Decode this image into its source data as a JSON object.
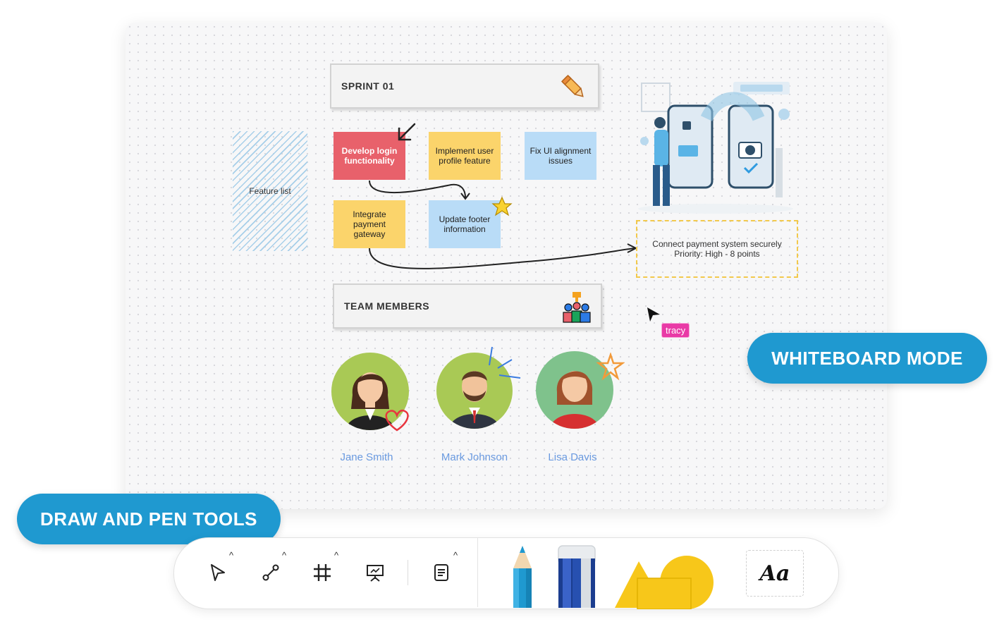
{
  "board": {
    "sprint_title": "SPRINT 01",
    "team_title": "TEAM MEMBERS",
    "feature_label": "Feature list",
    "stickies": [
      {
        "text": "Develop login functionality",
        "color": "#e8616b"
      },
      {
        "text": "Implement user profile feature",
        "color": "#fbd46b"
      },
      {
        "text": "Fix UI alignment issues",
        "color": "#b9dcf7"
      },
      {
        "text": "Integrate payment gateway",
        "color": "#fbd46b"
      },
      {
        "text": "Update footer information",
        "color": "#b9dcf7"
      }
    ],
    "payment_note": {
      "line1": "Connect payment system securely",
      "line2": "Priority: High - 8 points"
    },
    "members": [
      {
        "name": "Jane Smith"
      },
      {
        "name": "Mark Johnson"
      },
      {
        "name": "Lisa Davis"
      }
    ],
    "cursor_user": "tracy"
  },
  "badges": {
    "whiteboard_mode": "WHITEBOARD MODE",
    "draw_tools": "DRAW AND PEN TOOLS"
  },
  "toolbar": {
    "tools": [
      "select-icon",
      "connector-icon",
      "frame-icon",
      "presentation-icon",
      "notes-icon"
    ],
    "drawing_tools": [
      "pencil-icon",
      "eraser-icon",
      "shapes-icon"
    ],
    "font_label": "Aa"
  },
  "colors": {
    "accent": "#1f99d0",
    "cursor_tag": "#e93aa6",
    "member_name": "#6a9ae0"
  }
}
